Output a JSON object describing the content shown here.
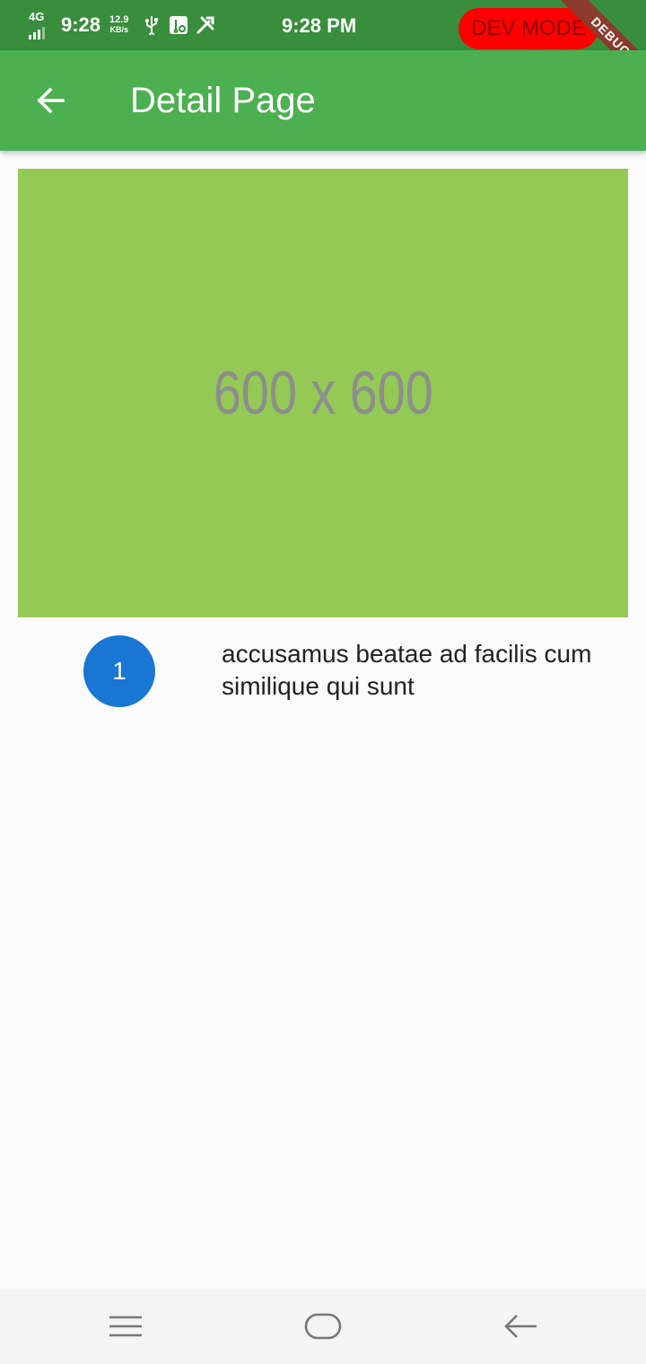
{
  "status_bar": {
    "network": "4G",
    "time_left": "9:28",
    "speed_value": "12.9",
    "speed_unit": "KB/s",
    "icons": [
      "usb-icon",
      "usb-debug-icon",
      "tools-icon"
    ],
    "time_center": "9:28 PM",
    "dev_mode_label": "DEV MODE",
    "debug_ribbon": "DEBUG"
  },
  "app_bar": {
    "title": "Detail Page",
    "back_icon": "arrow-back-icon",
    "color": "#4caf50"
  },
  "image": {
    "placeholder_text": "600 x 600",
    "background": "#93c954"
  },
  "item": {
    "avatar_text": "1",
    "avatar_color": "#1976d2",
    "title": "accusamus beatae ad facilis cum similique qui sunt"
  },
  "nav_bar": {
    "icons": [
      "menu-icon",
      "home-icon",
      "back-icon"
    ]
  }
}
